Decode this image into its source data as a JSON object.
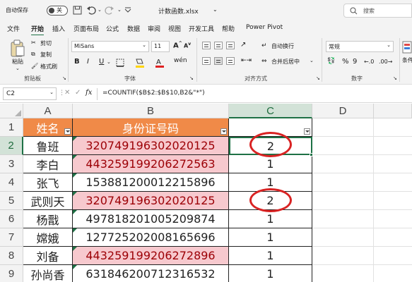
{
  "titlebar": {
    "autosave_label": "自动保存",
    "autosave_state": "关",
    "filename": "计数函数.xlsx",
    "search_placeholder": "搜索"
  },
  "menu": {
    "tabs": [
      "文件",
      "开始",
      "插入",
      "页面布局",
      "公式",
      "数据",
      "审阅",
      "视图",
      "开发工具",
      "帮助",
      "Power Pivot"
    ],
    "active_index": 1
  },
  "ribbon": {
    "clipboard": {
      "paste": "粘贴",
      "cut": "剪切",
      "copy": "复制",
      "format_painter": "格式刷",
      "label": "剪贴板"
    },
    "font": {
      "name": "MiSans",
      "size": "11",
      "label": "字体",
      "bold": "B",
      "italic": "I",
      "underline": "U"
    },
    "alignment": {
      "wrap": "自动换行",
      "merge": "合并后居中",
      "label": "对齐方式"
    },
    "number": {
      "format": "常规",
      "label": "数字"
    },
    "styles": {
      "label": "条件格式"
    }
  },
  "formula_bar": {
    "name_box": "C2",
    "fx": "fx",
    "formula": "=COUNTIF($B$2:$B$10,B2&\"*\")"
  },
  "grid": {
    "columns": [
      "A",
      "B",
      "C",
      "D"
    ],
    "rows": [
      "1",
      "2",
      "3",
      "4",
      "5",
      "6",
      "7",
      "8",
      "9"
    ],
    "header_row": {
      "a": "姓名",
      "b": "身份证号码",
      "c": ""
    },
    "data": [
      {
        "name": "鲁班",
        "id": "320749196302020125",
        "count": "2",
        "dup": true
      },
      {
        "name": "李白",
        "id": "443259199206272563",
        "count": "1",
        "dup": true
      },
      {
        "name": "张飞",
        "id": "153881200012215896",
        "count": "1",
        "dup": false
      },
      {
        "name": "武则天",
        "id": "320749196302020125",
        "count": "2",
        "dup": true
      },
      {
        "name": "杨戬",
        "id": "497818201005209874",
        "count": "1",
        "dup": false
      },
      {
        "name": "嫦娥",
        "id": "127725202008165696",
        "count": "1",
        "dup": false
      },
      {
        "name": "刘备",
        "id": "443259199206272896",
        "count": "1",
        "dup": true
      },
      {
        "name": "孙尚香",
        "id": "631846200712316532",
        "count": "1",
        "dup": false
      }
    ]
  },
  "colors": {
    "accent": "#1e7145",
    "header_fill": "#f08a48",
    "dup_fill": "#f7c9ce",
    "dup_text": "#9c0006",
    "circle": "#d92323"
  }
}
